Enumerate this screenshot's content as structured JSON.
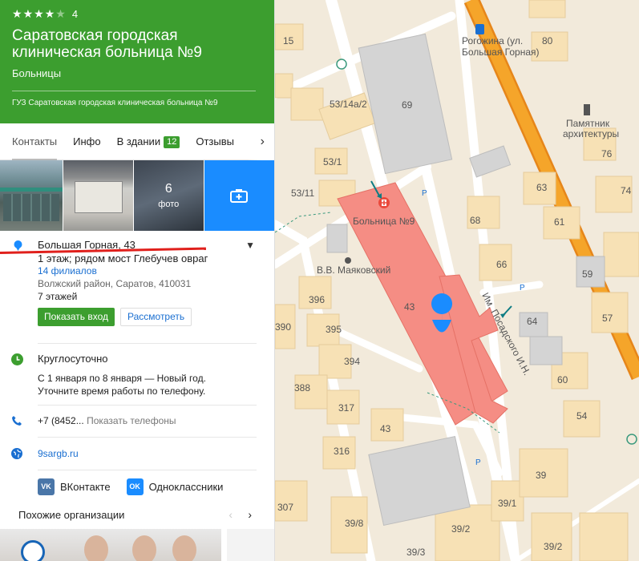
{
  "org": {
    "rating_value": "4",
    "stars_filled": 4,
    "stars_total": 5,
    "title": "Саратовская городская клиническая больница №9",
    "category": "Больницы",
    "legal_name": "ГУЗ Саратовская городская клиническая больница №9"
  },
  "tabs": [
    {
      "label": "Контакты",
      "active": true
    },
    {
      "label": "Инфо"
    },
    {
      "label": "В здании",
      "badge": "12"
    },
    {
      "label": "Отзывы"
    }
  ],
  "photos": {
    "count": "6",
    "label": "фото"
  },
  "address": {
    "street": "Большая Горная, 43",
    "detail": "1 этаж; рядом мост Глебучев овраг",
    "branches": "14 филиалов",
    "district": "Волжский район, Саратов, 410031",
    "floors": "7 этажей",
    "show_entrance": "Показать вход",
    "view": "Рассмотреть"
  },
  "hours": {
    "main": "Круглосуточно",
    "note_line1": "С 1 января по 8 января — Новый год.",
    "note_line2": "Уточните время работы по телефону."
  },
  "phone": {
    "number": "+7 (8452...",
    "show": "Показать телефоны"
  },
  "website": "9sargb.ru",
  "socials": [
    {
      "name": "ВКонтакте",
      "abbr": "VK",
      "color": "#4a76a8"
    },
    {
      "name": "Одноклассники",
      "abbr": "OK",
      "color": "#1a8cff"
    }
  ],
  "similar": {
    "label": "Похожие организации"
  },
  "colors": {
    "accent_green": "#3c9e2f",
    "link_blue": "#1a6fd1",
    "hospital_fill": "#f58d84",
    "road_orange": "#f39a1c"
  },
  "map": {
    "bus_stop": {
      "line1": "Рогожина (ул.",
      "line2": "Большая Горная)"
    },
    "monument": {
      "line1": "Памятник",
      "line2": "архитектуры"
    },
    "hospital_label": "Больница №9",
    "mayakovsky": "В.В. Маяковский",
    "street_label": "Им. Посадского И.Н.",
    "house_numbers": [
      "15",
      "80",
      "69",
      "53/14а/2",
      "76",
      "53/1",
      "63",
      "74",
      "53/11",
      "68",
      "61",
      "59",
      "66",
      "396",
      "43",
      "64",
      "57",
      "390",
      "395",
      "394",
      "60",
      "388",
      "317",
      "54",
      "43",
      "39",
      "316",
      "307",
      "39/1",
      "39/8",
      "39/2",
      "39/3",
      "39/2"
    ]
  }
}
